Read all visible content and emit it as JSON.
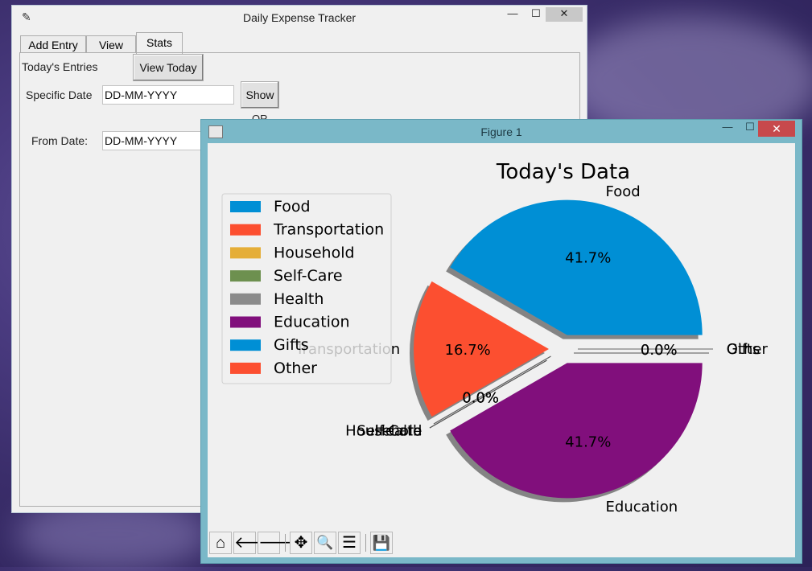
{
  "main_window": {
    "title": "Daily Expense Tracker",
    "minimize": "—",
    "maximize": "☐",
    "close": "✕",
    "tabs": [
      "Add Entry",
      "View",
      "Stats"
    ],
    "active_tab": "Stats",
    "todays_entries_label": "Today's Entries",
    "view_today_button": "View Today",
    "specific_date_label": "Specific Date",
    "specific_date_value": "DD-MM-YYYY",
    "show_button": "Show",
    "or_label": "OR",
    "from_date_label": "From Date:",
    "from_date_value": "DD-MM-YYYY"
  },
  "figure_window": {
    "title": "Figure 1",
    "minimize": "—",
    "maximize": "☐",
    "close": "✕"
  },
  "chart_data": {
    "type": "pie",
    "title": "Today's Data",
    "categories": [
      "Food",
      "Transportation",
      "Household",
      "Self-Care",
      "Health",
      "Education",
      "Gifts",
      "Other"
    ],
    "values": [
      41.7,
      16.7,
      0.0,
      0.0,
      0.0,
      41.7,
      0.0,
      0.0
    ],
    "value_labels": [
      "41.7%",
      "16.7%",
      "0.0%",
      "0.0%",
      "0.0%",
      "41.7%",
      "0.0%",
      "0.0%"
    ],
    "colors": [
      "#008fd5",
      "#fc4f30",
      "#e5ae38",
      "#6d904f",
      "#8b8b8b",
      "#810f7c",
      "#008fd5",
      "#fc4f30"
    ],
    "explode": true,
    "shadow": true,
    "legend_location": "upper-left"
  },
  "toolbar": {
    "icons": [
      "home-icon",
      "back-icon",
      "forward-icon",
      "pan-icon",
      "zoom-icon",
      "configure-subplots-icon",
      "save-icon"
    ]
  }
}
